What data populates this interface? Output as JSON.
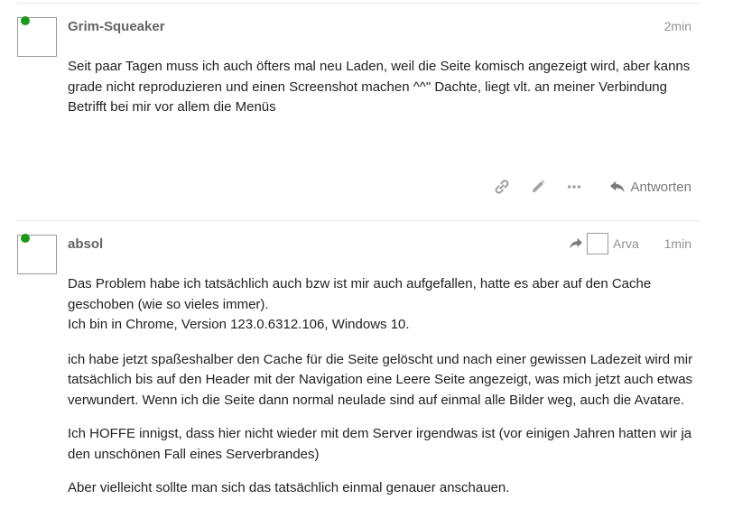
{
  "posts": [
    {
      "username": "Grim-Squeaker",
      "time": "2min",
      "paragraphs": [
        "Seit paar Tagen muss ich auch öfters mal neu Laden, weil die Seite komisch angezeigt wird, aber kanns grade nicht reproduzieren und einen Screenshot machen ^^\" Dachte, liegt vlt. an meiner Verbindung",
        "Betrifft bei mir vor allem die Menüs"
      ],
      "actions": {
        "link_icon": "link-icon",
        "edit_icon": "pencil-icon",
        "more_icon": "ellipsis-icon",
        "reply_label": "Antworten"
      }
    },
    {
      "username": "absol",
      "time": "1min",
      "reply_to": "Arva",
      "paragraphs": [
        "Das Problem habe ich tatsächlich auch bzw ist mir auch aufgefallen, hatte es aber auf den Cache geschoben (wie so vieles immer).",
        "Ich bin in Chrome, Version 123.0.6312.106, Windows 10.",
        "ich habe jetzt spaßeshalber den Cache für die Seite gelöscht und nach einer gewissen Ladezeit wird mir tatsächlich bis auf den Header mit der Navigation eine Leere Seite angezeigt, was mich jetzt auch etwas verwundert. Wenn ich die Seite dann normal neulade sind auf einmal alle Bilder weg, auch die Avatare.",
        "Ich HOFFE innigst, dass hier nicht wieder mit dem Server irgendwas ist (vor einigen Jahren hatten wir ja den unschönen Fall eines Serverbrandes)",
        "Aber vielleicht sollte man sich das tatsächlich einmal genauer anschauen."
      ]
    }
  ],
  "colors": {
    "online": "#1a9a1a",
    "muted": "#919191",
    "username": "#646464"
  }
}
